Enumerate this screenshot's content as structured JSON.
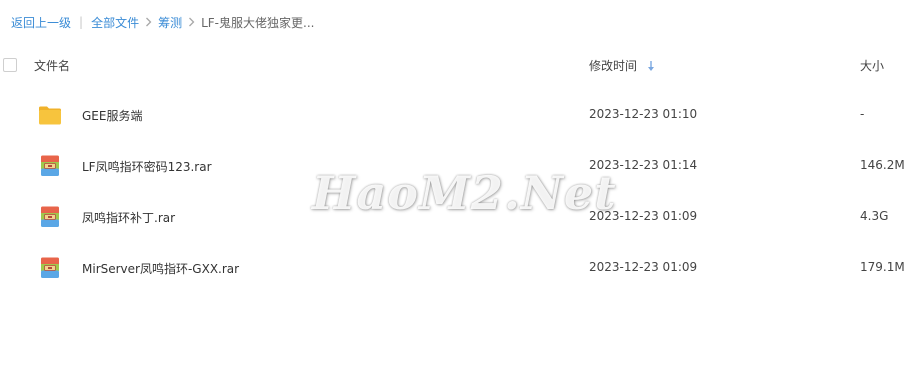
{
  "breadcrumb": {
    "back": "返回上一级",
    "separator": "|",
    "items": [
      {
        "label": "全部文件"
      },
      {
        "label": "筹测"
      }
    ],
    "current": "LF-鬼服大佬独家更..."
  },
  "table": {
    "headers": {
      "name": "文件名",
      "modified": "修改时间",
      "size": "大小"
    },
    "sort_icon": "sort-down-arrow-icon",
    "rows": [
      {
        "name": "GEE服务端",
        "modified": "2023-12-23 01:10",
        "size": "-",
        "icon": "folder-icon"
      },
      {
        "name": "LF凤鸣指环密码123.rar",
        "modified": "2023-12-23 01:14",
        "size": "146.2M",
        "icon": "rar-archive-icon"
      },
      {
        "name": "凤鸣指环补丁.rar",
        "modified": "2023-12-23 01:09",
        "size": "4.3G",
        "icon": "rar-archive-icon"
      },
      {
        "name": "MirServer凤鸣指环-GXX.rar",
        "modified": "2023-12-23 01:09",
        "size": "179.1M",
        "icon": "rar-archive-icon"
      }
    ]
  },
  "watermark": "HaoM2.Net",
  "colors": {
    "link": "#3b8cd6",
    "folder": "#f7c43d",
    "sort_icon": "#7aa7e0"
  }
}
